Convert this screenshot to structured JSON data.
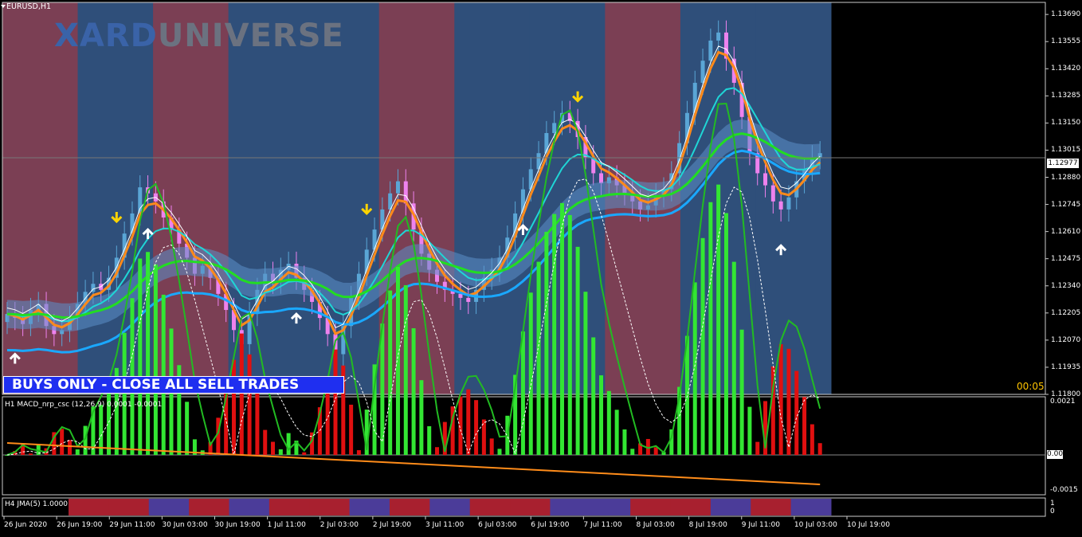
{
  "chart_title": "EURUSD,H1",
  "watermark": {
    "part1": "XARD",
    "part2": "UNIVERSE"
  },
  "banner_text": "BUYS ONLY - CLOSE ALL SELL TRADES",
  "timer": "00:05",
  "current_price": "1.12977",
  "colors": {
    "background": "#000000",
    "bull_zone": "#2f4f7a",
    "bear_zone": "#7b3f54",
    "candle_up": "#5aa6d6",
    "candle_down": "#ee82ee",
    "banner": "#1f2ff0",
    "macd_pos": "#33e633",
    "macd_neg": "#e01010",
    "jma_pos": "#4b3c99",
    "jma_neg": "#a8202f"
  },
  "price_axis": [
    "1.13690",
    "1.13555",
    "1.13420",
    "1.13285",
    "1.13150",
    "1.13015",
    "1.12880",
    "1.12745",
    "1.12610",
    "1.12475",
    "1.12340",
    "1.12205",
    "1.12070",
    "1.11935",
    "1.11800"
  ],
  "time_axis": [
    "26 Jun 2020",
    "26 Jun 19:00",
    "29 Jun 11:00",
    "30 Jun 03:00",
    "30 Jun 19:00",
    "1 Jul 11:00",
    "2 Jul 03:00",
    "2 Jul 19:00",
    "3 Jul 11:00",
    "6 Jul 03:00",
    "6 Jul 19:00",
    "7 Jul 11:00",
    "8 Jul 03:00",
    "8 Jul 19:00",
    "9 Jul 11:00",
    "10 Jul 03:00",
    "10 Jul 19:00"
  ],
  "macd": {
    "label": "H1 MACD_nrp_csc (12,26,9) 0.0001 -0.0001",
    "axis_top": "0.0021",
    "axis_zero": "0.00",
    "axis_bottom": "-0.0015"
  },
  "jma": {
    "label": "H4 JMA(5) 1.0000",
    "axis_top": "1",
    "axis_bottom": "0"
  },
  "chart_data": {
    "type": "candlestick",
    "symbol": "EURUSD",
    "timeframe": "H1",
    "ylim": [
      1.118,
      1.1375
    ],
    "zones": [
      "bear",
      "bull",
      "bear",
      "bull",
      "bull",
      "bear",
      "bull",
      "bull",
      "bear",
      "bull",
      "bull"
    ],
    "closes": [
      1.122,
      1.1218,
      1.1215,
      1.1222,
      1.1225,
      1.1214,
      1.121,
      1.1212,
      1.1218,
      1.1225,
      1.1231,
      1.1235,
      1.1232,
      1.1238,
      1.1248,
      1.126,
      1.127,
      1.1283,
      1.128,
      1.1276,
      1.1268,
      1.1262,
      1.1255,
      1.1248,
      1.124,
      1.1244,
      1.1238,
      1.123,
      1.1222,
      1.1212,
      1.1205,
      1.122,
      1.1232,
      1.124,
      1.1236,
      1.1242,
      1.1245,
      1.1238,
      1.1232,
      1.1226,
      1.1218,
      1.121,
      1.12,
      1.1214,
      1.1228,
      1.124,
      1.1252,
      1.1262,
      1.1272,
      1.128,
      1.1286,
      1.1275,
      1.1262,
      1.125,
      1.1242,
      1.1236,
      1.1232,
      1.123,
      1.1228,
      1.1226,
      1.1232,
      1.1238,
      1.1242,
      1.1248,
      1.1258,
      1.127,
      1.1282,
      1.1292,
      1.13,
      1.131,
      1.1315,
      1.132,
      1.1316,
      1.1308,
      1.1298,
      1.129,
      1.1285,
      1.1288,
      1.1284,
      1.128,
      1.1276,
      1.1272,
      1.1274,
      1.1279,
      1.1282,
      1.129,
      1.1305,
      1.132,
      1.1335,
      1.1346,
      1.1356,
      1.136,
      1.1347,
      1.1335,
      1.1318,
      1.13,
      1.129,
      1.1284,
      1.1276,
      1.1272,
      1.1278,
      1.1286,
      1.1292,
      1.1298,
      1.13
    ]
  }
}
